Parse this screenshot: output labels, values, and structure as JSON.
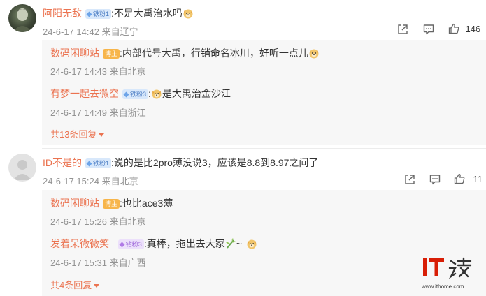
{
  "comment1": {
    "username": "阿阳无敌",
    "badge": "铁粉1",
    "text": ":不是大禹治水吗",
    "time_location": "24-6-17 14:42 来自辽宁",
    "likes": "146",
    "replies": [
      {
        "username": "数码闲聊站",
        "badge": "博主",
        "text": ":内部代号大禹，行销命名冰川，好听一点儿",
        "time_location": "24-6-17 14:43 来自北京"
      },
      {
        "username": "有梦一起去微空",
        "badge": "铁粉3",
        "text": ":",
        "text_after": "是大禹治金沙江",
        "time_location": "24-6-17 14:49 来自浙江"
      }
    ],
    "more_replies": "共13条回复"
  },
  "comment2": {
    "username": "ID不是的",
    "badge": "铁粉1",
    "text": ":说的是比2pro薄没说3，应该是8.8到8.97之间了",
    "time_location": "24-6-17 15:24 来自北京",
    "likes": "11",
    "replies": [
      {
        "username": "数码闲聊站",
        "badge": "博主",
        "text": ":也比ace3薄",
        "time_location": "24-6-17 15:26 来自北京"
      },
      {
        "username": "发着呆微微笑_",
        "badge": "钻粉3",
        "text": ":真棒，拖出去大家",
        "text_after": "~",
        "time_location": "24-6-17 15:31 来自广西"
      }
    ],
    "more_replies": "共4条回复"
  },
  "watermark": {
    "logo_text": "IT之家",
    "url": "www.ithome.com"
  },
  "colors": {
    "accent": "#eb7350",
    "meta": "#939393",
    "badge_fan": "#4a7cc3",
    "badge_host": "#f7b54a",
    "reply_bg": "#f7f7f7"
  },
  "icons": [
    "share-icon",
    "comment-icon",
    "like-icon",
    "doge-emoji",
    "bamboo-emoji"
  ]
}
